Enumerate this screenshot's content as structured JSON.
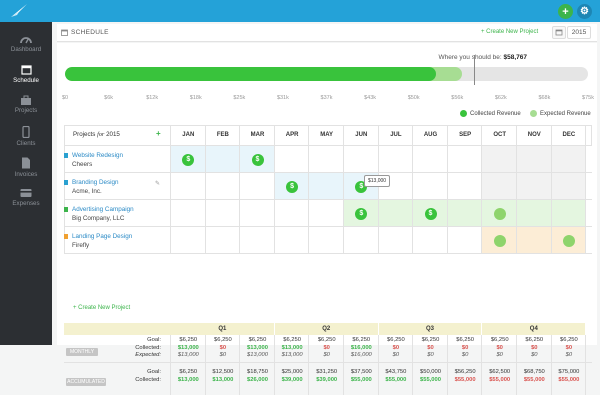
{
  "topbar": {
    "plus_label": "+",
    "gear_label": "⚙"
  },
  "sidebar": {
    "items": [
      {
        "label": "Dashboard",
        "icon": "dashboard-icon",
        "active": false
      },
      {
        "label": "Schedule",
        "icon": "calendar-icon",
        "active": true
      },
      {
        "label": "Projects",
        "icon": "briefcase-icon",
        "active": false
      },
      {
        "label": "Clients",
        "icon": "phone-icon",
        "active": false
      },
      {
        "label": "Invoices",
        "icon": "document-icon",
        "active": false
      },
      {
        "label": "Expenses",
        "icon": "credit-card-icon",
        "active": false
      }
    ]
  },
  "header": {
    "title": "SCHEDULE",
    "create_label": "+ Create New Project",
    "year": "2015"
  },
  "progress": {
    "where_label": "Where you should be:",
    "where_value": "$58,767",
    "collected_fraction": 0.71,
    "expected_fraction": 0.76,
    "axis_ticks": [
      "$0",
      "$6k",
      "$12k",
      "$18k",
      "$25k",
      "$31k",
      "$37k",
      "$43k",
      "$50k",
      "$56k",
      "$62k",
      "$68k",
      "$75k"
    ],
    "legend_collected": "Collected Revenue",
    "legend_expected": "Expected Revenue",
    "color_collected": "#39c33c",
    "color_expected": "#a7dd93"
  },
  "table": {
    "projects_label": "Projects",
    "projects_for": "for",
    "projects_year": "2015",
    "add_label": "+",
    "months": [
      "JAN",
      "FEB",
      "MAR",
      "APR",
      "MAY",
      "JUN",
      "JUL",
      "AUG",
      "SEP",
      "OCT",
      "NOV",
      "DEC"
    ],
    "projects": [
      {
        "name": "Website Redesign",
        "client": "Cheers",
        "color": "#2aa0d0"
      },
      {
        "name": "Branding Design",
        "client": "Acme, Inc.",
        "color": "#2aa0d0"
      },
      {
        "name": "Advertising Campaign",
        "client": "Big Company, LLC",
        "color": "#3cb44b"
      },
      {
        "name": "Landing Page Design",
        "client": "Firefly",
        "color": "#f0a030"
      }
    ],
    "dollar_glyph": "$",
    "tooltip": "$13,000",
    "new_project_label": "+ Create New Project"
  },
  "summary": {
    "quarters": [
      "Q1",
      "Q2",
      "Q3",
      "Q4"
    ],
    "monthly_tag": "MONTHLY",
    "accumulated_tag": "ACCUMULATED",
    "goal_label": "Goal:",
    "collected_label": "Collected:",
    "expected_label": "Expected:",
    "monthly": [
      {
        "goal": "$6,250",
        "collected": "$13,000",
        "expected": "$13,000"
      },
      {
        "goal": "$6,250",
        "collected": "$0",
        "expected": "$0"
      },
      {
        "goal": "$6,250",
        "collected": "$13,000",
        "expected": "$13,000"
      },
      {
        "goal": "$6,250",
        "collected": "$13,000",
        "expected": "$13,000"
      },
      {
        "goal": "$6,250",
        "collected": "$0",
        "expected": "$0"
      },
      {
        "goal": "$6,250",
        "collected": "$16,000",
        "expected": "$16,000"
      },
      {
        "goal": "$6,250",
        "collected": "$0",
        "expected": "$0"
      },
      {
        "goal": "$6,250",
        "collected": "$0",
        "expected": "$0"
      },
      {
        "goal": "$6,250",
        "collected": "$0",
        "expected": "$0"
      },
      {
        "goal": "$6,250",
        "collected": "$0",
        "expected": "$0"
      },
      {
        "goal": "$6,250",
        "collected": "$0",
        "expected": "$0"
      },
      {
        "goal": "$6,250",
        "collected": "$0",
        "expected": "$0"
      }
    ],
    "accumulated": [
      {
        "goal": "$6,250",
        "collected": "$13,000"
      },
      {
        "goal": "$12,500",
        "collected": "$13,000"
      },
      {
        "goal": "$18,750",
        "collected": "$26,000"
      },
      {
        "goal": "$25,000",
        "collected": "$39,000"
      },
      {
        "goal": "$31,250",
        "collected": "$39,000"
      },
      {
        "goal": "$37,500",
        "collected": "$55,000"
      },
      {
        "goal": "$43,750",
        "collected": "$55,000"
      },
      {
        "goal": "$50,000",
        "collected": "$55,000"
      },
      {
        "goal": "$56,250",
        "collected": "$55,000"
      },
      {
        "goal": "$62,500",
        "collected": "$55,000"
      },
      {
        "goal": "$68,750",
        "collected": "$55,000"
      },
      {
        "goal": "$75,000",
        "collected": "$55,000"
      }
    ]
  }
}
